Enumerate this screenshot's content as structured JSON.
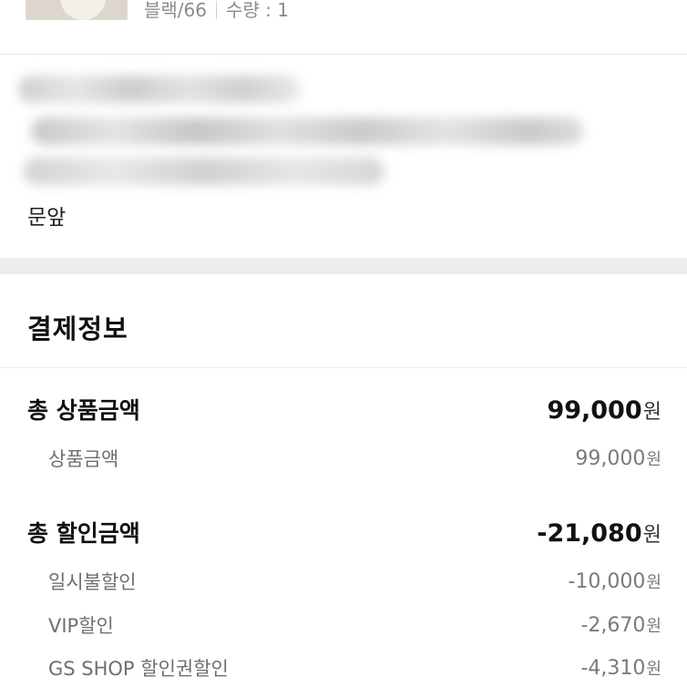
{
  "product": {
    "option": "블랙/66",
    "quantity": "수량 : 1"
  },
  "address": {
    "delivery_note": "문앞"
  },
  "payment": {
    "title": "결제정보",
    "currency_unit": "원",
    "total_product": {
      "label": "총 상품금액",
      "value": "99,000",
      "items": [
        {
          "label": "상품금액",
          "value": "99,000"
        }
      ]
    },
    "total_discount": {
      "label": "총 할인금액",
      "value": "-21,080",
      "items": [
        {
          "label": "일시불할인",
          "value": "-10,000"
        },
        {
          "label": "VIP할인",
          "value": "-2,670"
        },
        {
          "label": "GS SHOP 할인권할인",
          "value": "-4,310"
        }
      ]
    }
  },
  "colors": {
    "section_band": "#eeeeee",
    "divider": "#ececec",
    "sub_text": "#6f6f6f"
  }
}
